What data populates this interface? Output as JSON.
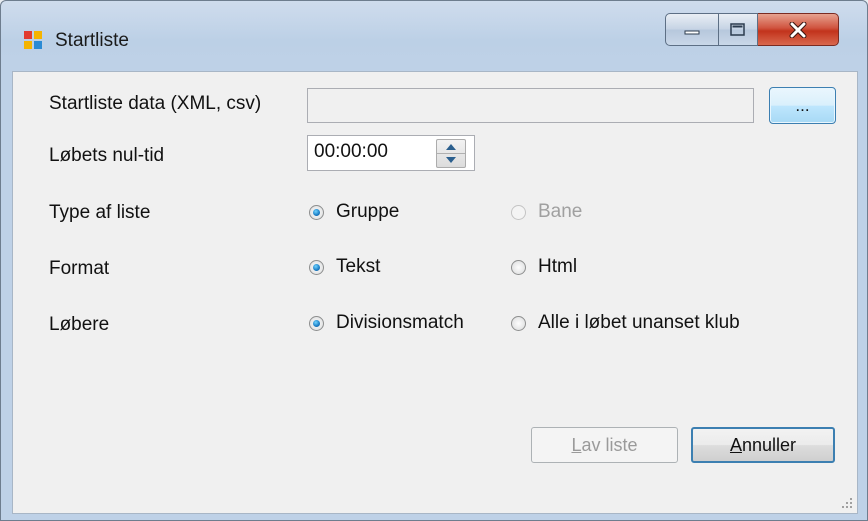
{
  "window": {
    "title": "Startliste",
    "controls": {
      "minimize_icon": "minimize-icon",
      "maximize_icon": "maximize-icon",
      "close_icon": "close-icon"
    }
  },
  "form": {
    "data_label": "Startliste data (XML, csv)",
    "data_value": "",
    "browse_label": "...",
    "zero_time_label": "Løbets nul-tid",
    "zero_time_value": "00:00:00",
    "type_label": "Type af liste",
    "type_options": [
      {
        "label": "Gruppe",
        "checked": true,
        "enabled": true
      },
      {
        "label": "Bane",
        "checked": false,
        "enabled": false
      }
    ],
    "format_label": "Format",
    "format_options": [
      {
        "label": "Tekst",
        "checked": true,
        "enabled": true
      },
      {
        "label": "Html",
        "checked": false,
        "enabled": true
      }
    ],
    "runners_label": "Løbere",
    "runners_options": [
      {
        "label": "Divisionsmatch",
        "checked": true,
        "enabled": true
      },
      {
        "label": "Alle i løbet unanset klub",
        "checked": false,
        "enabled": true
      }
    ]
  },
  "buttons": {
    "create": {
      "label": "Lav liste",
      "mnemonic": "L",
      "rest": "av liste",
      "enabled": false
    },
    "cancel": {
      "label": "Annuller",
      "mnemonic": "A",
      "rest": "nnuller",
      "enabled": true
    }
  },
  "colors": {
    "accent": "#3c7fb1",
    "close": "#c2331c",
    "radio_checked": "#1a7cc4"
  }
}
